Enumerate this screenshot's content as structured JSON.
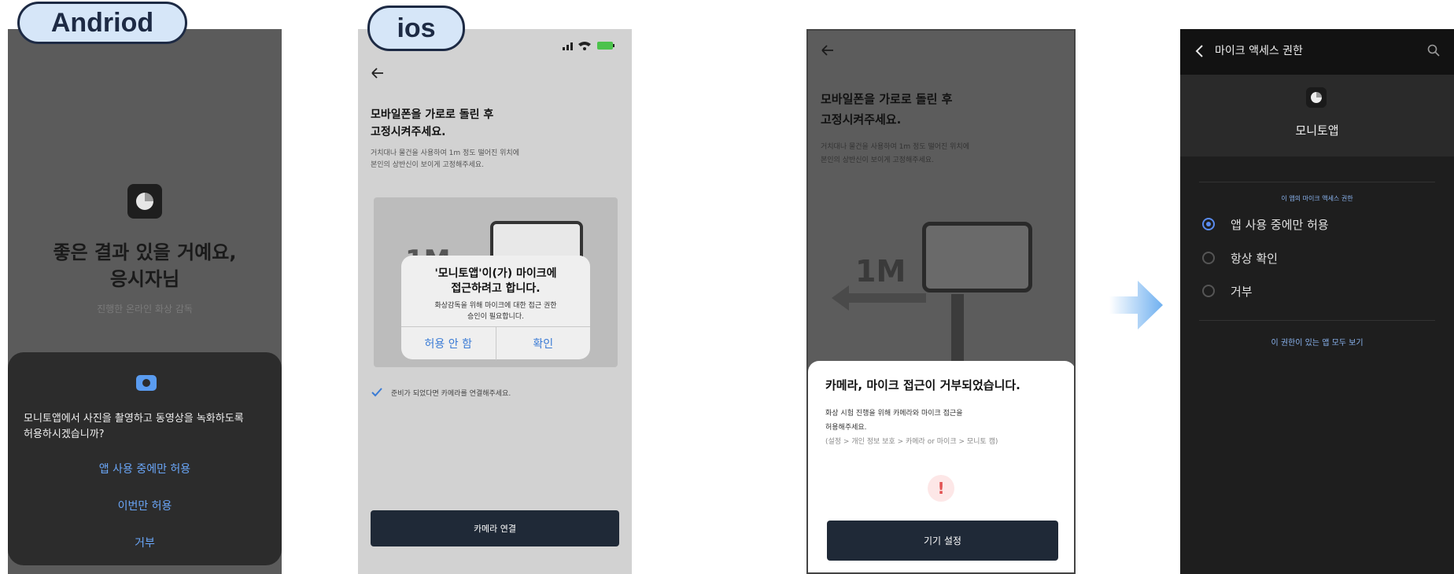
{
  "labels": {
    "android": "Andriod",
    "ios": "ios"
  },
  "android": {
    "headline_line1": "좋은 결과 있을 거예요,",
    "headline_line2": "응시자님",
    "subtitle": "진행한 온라인 화상 감독",
    "dialog_text_line1": "모니토앱에서 사진을 촬영하고 동영상을 녹화하도록",
    "dialog_text_line2": "허용하시겠습니까?",
    "options": [
      "앱 사용 중에만 허용",
      "이번만 허용",
      "거부"
    ]
  },
  "ios": {
    "title_line1": "모바일폰을 가로로 돌린 후",
    "title_line2": "고정시켜주세요.",
    "desc_line1": "거치대나 물건을 사용하여 1m 정도 떨어진 위치에",
    "desc_line2": "본인의 상반신이 보이게 고정해주세요.",
    "distance_label": "1M",
    "alert_title_line1": "'모니토앱'이(가) 마이크에",
    "alert_title_line2": "접근하려고 합니다.",
    "alert_body_line1": "화상감독을 위해 마이크에 대한 접근 권한",
    "alert_body_line2": "승인이 필요합니다.",
    "alert_deny": "허용 안 함",
    "alert_ok": "확인",
    "ready_text": "준비가 되었다면 카메라를 연결해주세요.",
    "connect_button": "카메라 연결"
  },
  "denied": {
    "title_line1": "모바일폰을 가로로 돌린 후",
    "title_line2": "고정시켜주세요.",
    "desc_line1": "거치대나 물건을 사용하여 1m 정도 떨어진 위치에",
    "desc_line2": "본인의 상반신이 보이게 고정해주세요.",
    "distance_label": "1M",
    "sheet_title": "카메라, 마이크 접근이 거부되었습니다.",
    "sheet_body_line1": "화상 시험 진행을 위해 카메라와 마이크 접근을",
    "sheet_body_line2": "허용해주세요.",
    "sheet_path": "(설정 > 개인 정보 보호 > 카메라 or 마이크 > 모니토 캠)",
    "warn_mark": "!",
    "settings_button": "기기 설정"
  },
  "settings": {
    "header_title": "마이크 액세스 권한",
    "app_name": "모니토앱",
    "section_label": "이 앱의 마이크 액세스 권한",
    "options": [
      {
        "label": "앱 사용 중에만 허용",
        "selected": true
      },
      {
        "label": "항상 확인",
        "selected": false
      },
      {
        "label": "거부",
        "selected": false
      }
    ],
    "footer_link": "이 권한이 있는 앱 모두 보기"
  },
  "colors": {
    "accent_blue": "#5a8cf0",
    "dark_button": "#1f2937",
    "arrow": "#8cc2f5",
    "warn_red": "#e25252"
  },
  "icons": [
    "back-arrow-icon",
    "search-icon",
    "camera-icon",
    "check-icon",
    "warning-icon",
    "signal-icon",
    "wifi-icon",
    "battery-icon",
    "right-arrow-icon"
  ]
}
